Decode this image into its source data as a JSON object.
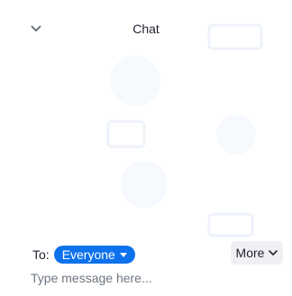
{
  "header": {
    "title": "Chat",
    "collapse_icon": "chevron-down-icon"
  },
  "composer": {
    "to_label": "To:",
    "recipient": "Everyone",
    "recipient_icon": "caret-down-icon",
    "more_label": "More",
    "more_icon": "chevron-down-icon",
    "placeholder": "Type message here..."
  },
  "colors": {
    "accent": "#0e72ed",
    "text": "#232333",
    "button_bg": "#f0f0f4",
    "placeholder": "#6e7680"
  }
}
